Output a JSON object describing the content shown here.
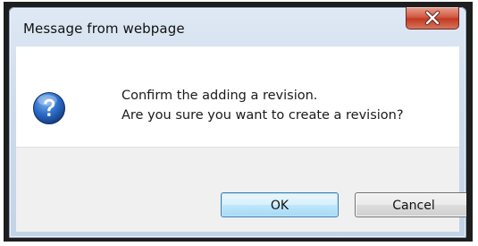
{
  "dialog": {
    "title": "Message from webpage",
    "close_icon": "close-icon",
    "message_icon": "question-icon",
    "message_lines": [
      "Confirm the adding a revision.",
      "Are you sure you want to create a revision?"
    ],
    "buttons": {
      "ok_label": "OK",
      "cancel_label": "Cancel"
    }
  },
  "colors": {
    "close_button": "#c13a22",
    "default_button_border": "#3c7fb1",
    "question_icon": "#1f5fb5"
  }
}
